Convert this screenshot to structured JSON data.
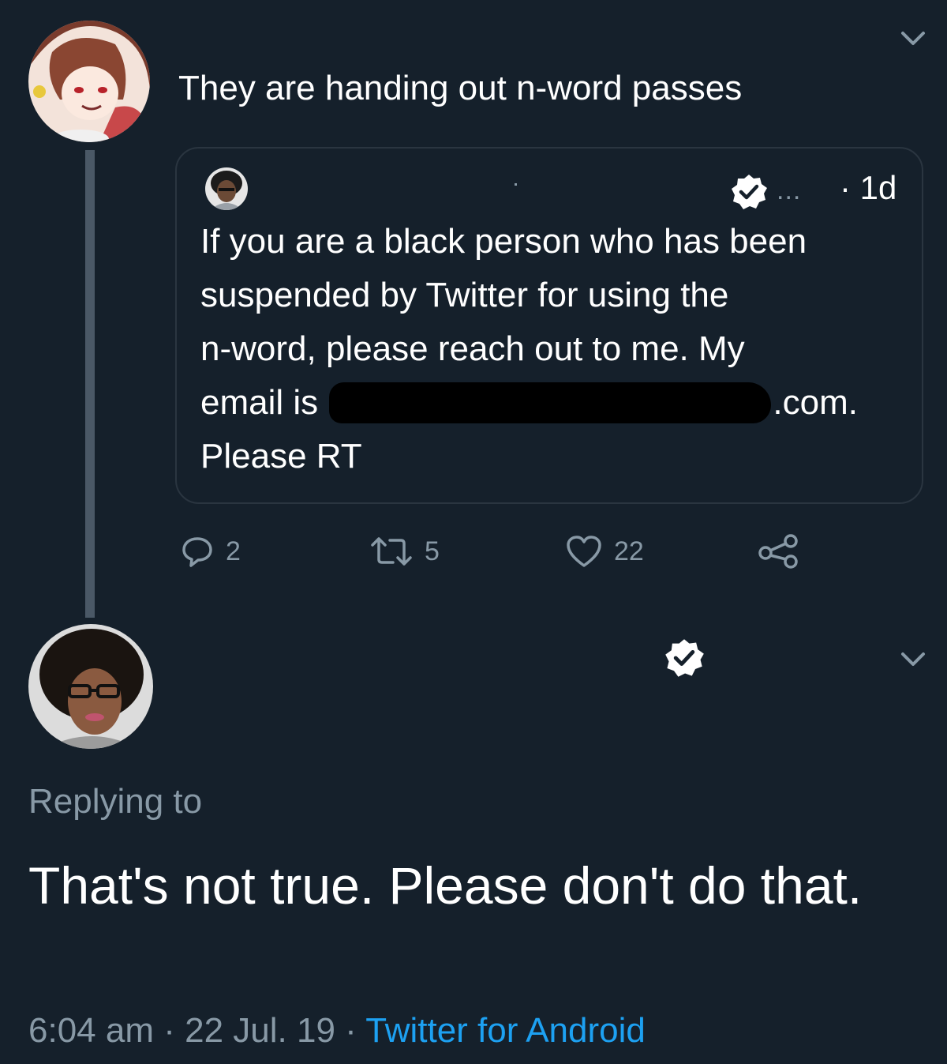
{
  "top_tweet": {
    "text": "They are handing out n-word passes"
  },
  "quoted_tweet": {
    "more": "...",
    "time": "· 1d",
    "lines": [
      "If you are a black person who has been",
      "suspended by Twitter for using the",
      "n-word, please reach out to me. My"
    ],
    "email_prefix": "email is",
    "email_suffix": ".com.",
    "last_line": "Please RT"
  },
  "actions": {
    "replies": "2",
    "retweets": "5",
    "likes": "22"
  },
  "reply_tweet": {
    "replying_to": "Replying to",
    "text": "That's not true. Please don't do that.",
    "time": "6:04 am",
    "separator": "·",
    "date": "22 Jul. 19",
    "source": "Twitter for Android"
  },
  "icons": {
    "chevron": "chevron-down-icon",
    "verified": "verified-badge-icon",
    "reply": "reply-icon",
    "retweet": "retweet-icon",
    "like": "heart-icon",
    "share": "share-icon"
  },
  "colors": {
    "background": "#15202b",
    "text": "#ffffff",
    "secondary": "#8899a6",
    "link": "#1da1f2",
    "border": "#2a3540",
    "thread_line": "#4a5866"
  }
}
